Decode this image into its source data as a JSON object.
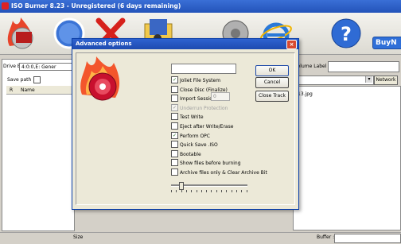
{
  "app": {
    "title": "ISO Burner 8.23 - Unregistered (6 days remaining)",
    "buy_label": "BuyN"
  },
  "toolbar": {
    "icons": [
      "burn-disc-icon",
      "iso-icon",
      "delete-icon",
      "folder-music-icon",
      "settings-icon",
      "internet-explorer-icon",
      "help-icon"
    ]
  },
  "left_panel": {
    "drive_label": "Drive E:",
    "drive_value": "4:0:0,E: Gener",
    "save_path_label": "Save path",
    "col_r": "R",
    "col_name": "Name"
  },
  "right_panel": {
    "volume_label": "Volume Label :",
    "network_label": "Network",
    "file_item": "13.jpg"
  },
  "status": {
    "size_label": "Size",
    "buffer_label": "Buffer :"
  },
  "dialog": {
    "title": "Advanced options",
    "close_glyph": "×",
    "options": [
      {
        "label": "Joliet File System",
        "checked": true,
        "disabled": false
      },
      {
        "label": "Close Disc (Finalize)",
        "checked": false,
        "disabled": false
      },
      {
        "label": "Import Session",
        "checked": false,
        "disabled": false
      },
      {
        "label": "Underrun Protection",
        "checked": true,
        "disabled": true
      },
      {
        "label": "Test Write",
        "checked": false,
        "disabled": false
      },
      {
        "label": "Eject after Write/Erase",
        "checked": false,
        "disabled": false
      },
      {
        "label": "Perform OPC",
        "checked": true,
        "disabled": false
      },
      {
        "label": "Quick Save .ISO",
        "checked": false,
        "disabled": false
      },
      {
        "label": "Bootable",
        "checked": false,
        "disabled": false
      },
      {
        "label": "Show files before burning",
        "checked": false,
        "disabled": false
      },
      {
        "label": "Archive files only & Clear Archive Bit",
        "checked": false,
        "disabled": false
      }
    ],
    "session_value": "0",
    "ok_label": "OK",
    "cancel_label": "Cancel",
    "close_track_label": "Close Track",
    "slider_level": 0.12
  }
}
